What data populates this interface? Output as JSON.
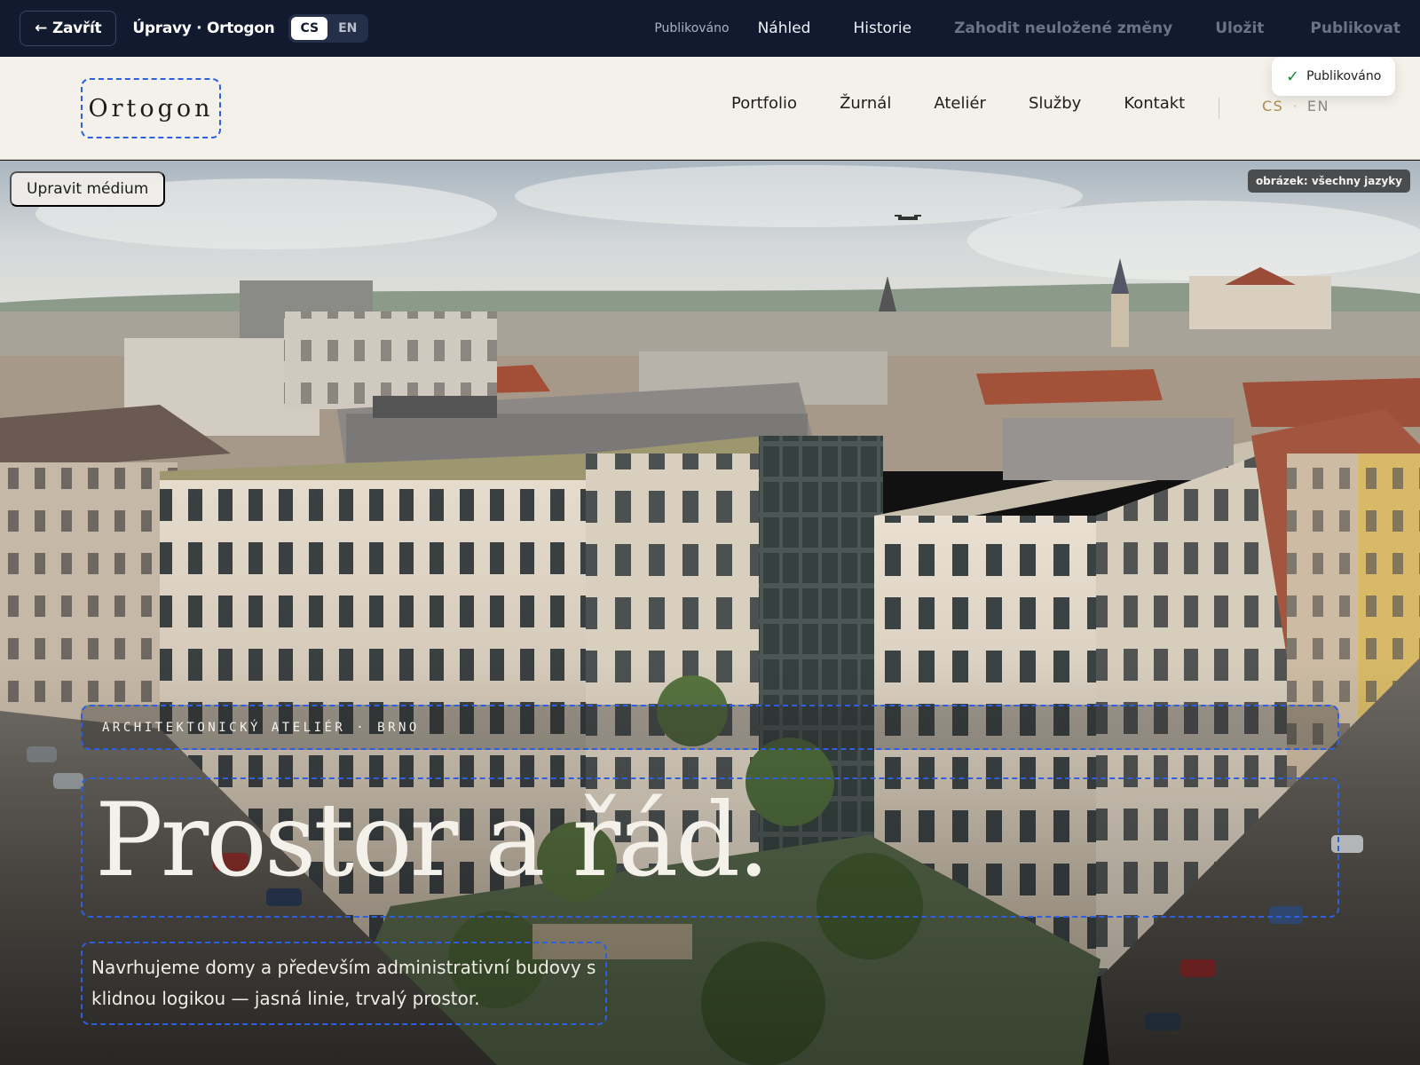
{
  "editor": {
    "close_label": "Zavřít",
    "title": "Úpravy · Ortogon",
    "languages": [
      "CS",
      "EN"
    ],
    "active_language": "CS",
    "status": "Publikováno",
    "actions": {
      "preview": "Náhled",
      "history": "Historie",
      "discard": "Zahodit neuložené změny",
      "save": "Uložit",
      "publish": "Publikovat"
    }
  },
  "toast": {
    "label": "Publikováno",
    "icon": "check-icon"
  },
  "site": {
    "logo": "Ortogon",
    "nav": [
      "Portfolio",
      "Žurnál",
      "Ateliér",
      "Služby",
      "Kontakt"
    ],
    "languages": {
      "cs": "CS",
      "separator": "·",
      "en": "EN"
    }
  },
  "hero": {
    "edit_media_label": "Upravit médium",
    "image_scope": "obrázek: všechny jazyky",
    "eyebrow": "ARCHITEKTONICKÝ ATELIÉR · BRNO",
    "headline": "Prostor a řád.",
    "lede": "Navrhujeme domy a především administrativní budovy s klidnou logikou — jasná linie, trvalý prostor."
  },
  "colors": {
    "toolbar_bg": "#111a2e",
    "header_bg": "#f4f1ea",
    "edit_outline": "#2d5fe0",
    "accent_lang": "#b08a4e"
  }
}
